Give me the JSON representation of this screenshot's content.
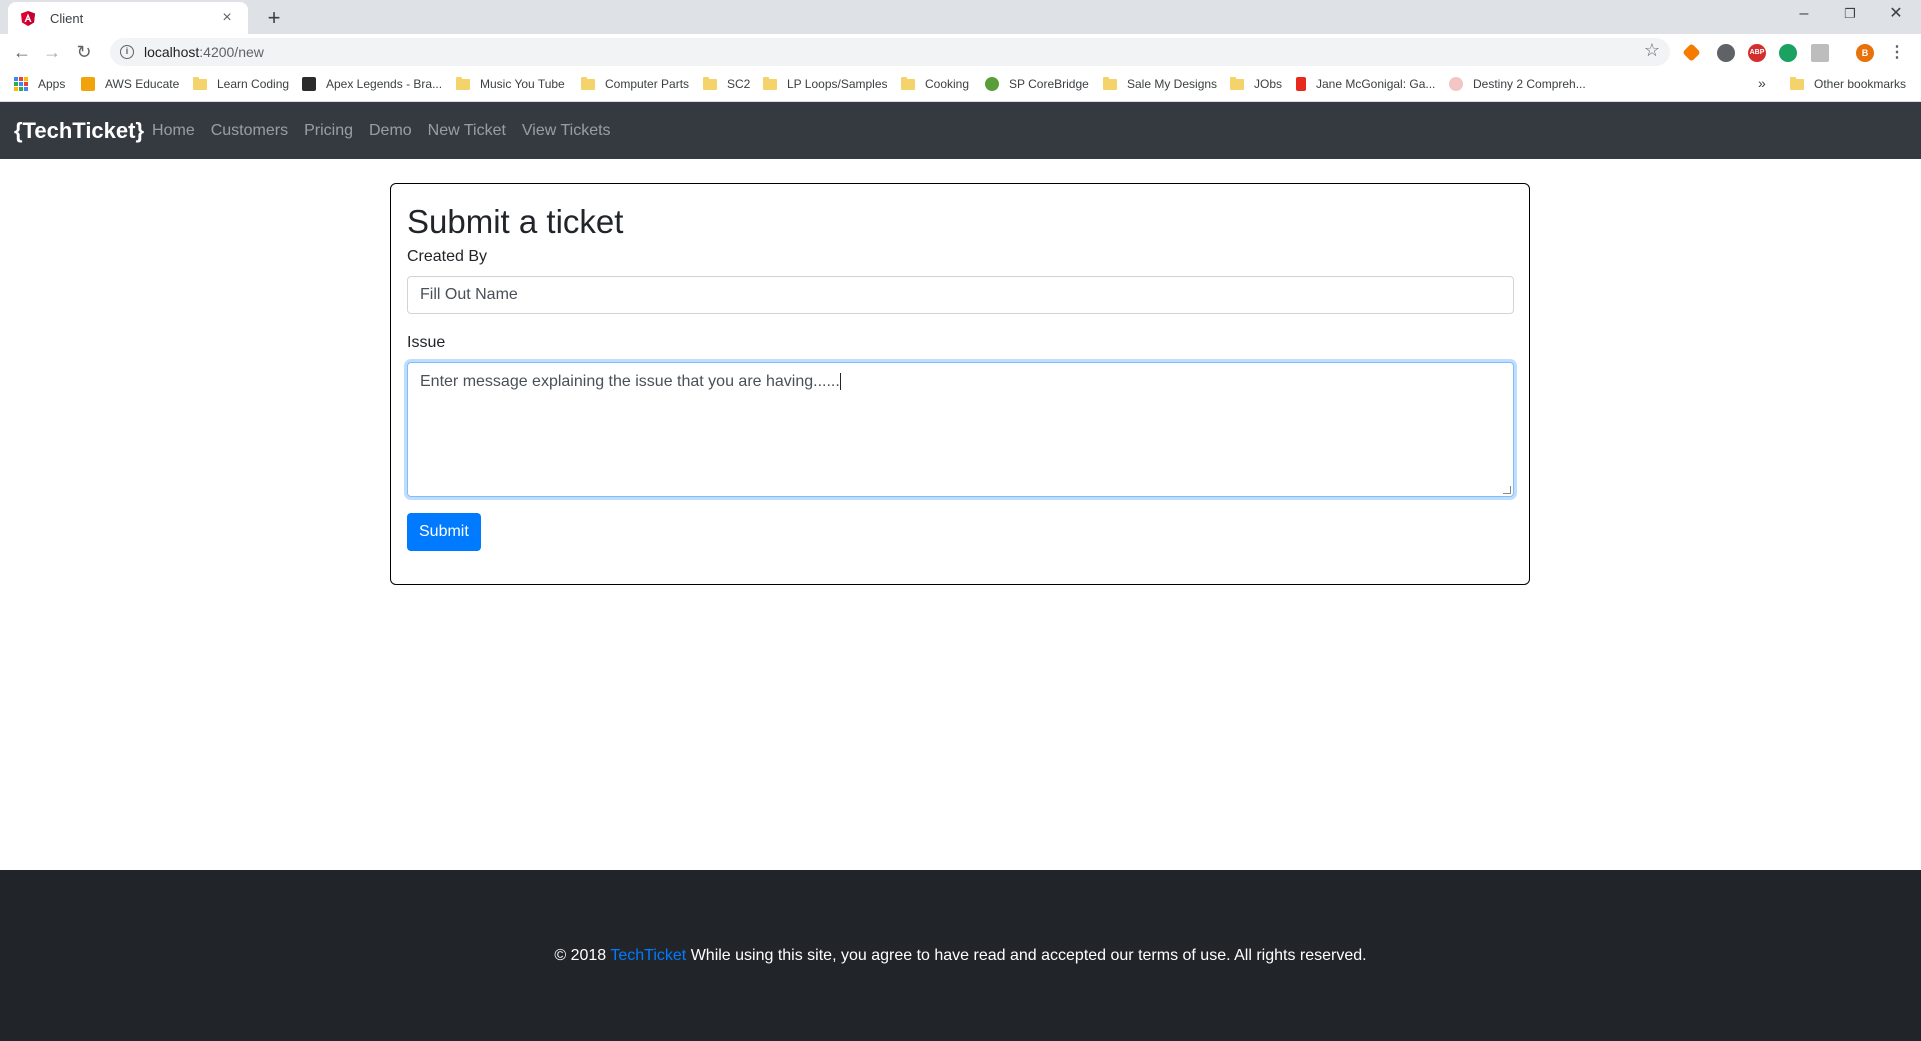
{
  "browser": {
    "tab_title": "Client",
    "url_host": "localhost",
    "url_path": ":4200/new",
    "new_tab_symbol": "+",
    "window_controls": {
      "minimize": "–",
      "restore": "❐",
      "close": "✕"
    },
    "nav_icons": {
      "back": "←",
      "forward": "→",
      "reload": "↻",
      "star": "☆"
    }
  },
  "bookmarks": [
    {
      "label": "Apps"
    },
    {
      "label": "AWS Educate"
    },
    {
      "label": "Learn Coding"
    },
    {
      "label": "Apex Legends - Bra..."
    },
    {
      "label": "Music You Tube"
    },
    {
      "label": "Computer Parts"
    },
    {
      "label": "SC2"
    },
    {
      "label": "LP Loops/Samples"
    },
    {
      "label": "Cooking"
    },
    {
      "label": "SP CoreBridge"
    },
    {
      "label": "Sale My Designs"
    },
    {
      "label": "JObs"
    },
    {
      "label": "Jane McGonigal: Ga..."
    },
    {
      "label": "Destiny 2 Compreh..."
    }
  ],
  "bookmarks_more": "»",
  "other_bookmarks": "Other bookmarks",
  "extensions": {
    "abp": "ABP",
    "profile": "B"
  },
  "navbar": {
    "brand": "{TechTicket}",
    "links": [
      "Home",
      "Customers",
      "Pricing",
      "Demo",
      "New Ticket",
      "View Tickets"
    ]
  },
  "form": {
    "title": "Submit a ticket",
    "created_by_label": "Created By",
    "created_by_placeholder": "Fill Out Name",
    "issue_label": "Issue",
    "issue_value": "Enter message explaining the issue that you are having......",
    "submit_label": "Submit"
  },
  "footer": {
    "copyright": "© 2018",
    "brand_link": "TechTicket",
    "text": "While using this site, you agree to have read and accepted our terms of use. All rights reserved."
  },
  "colors": {
    "navbar_bg": "#343a40",
    "footer_bg": "#212529",
    "primary": "#007bff"
  }
}
